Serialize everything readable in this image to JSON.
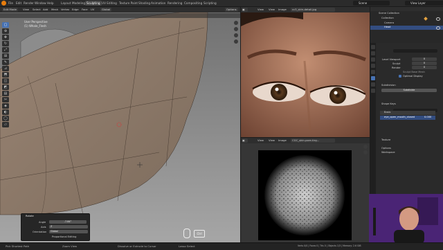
{
  "topbar": {
    "menus": [
      "File",
      "Edit",
      "Render",
      "Window",
      "Help"
    ],
    "workspaces": [
      "Layout",
      "Modeling",
      "Sculpting",
      "UV Editing",
      "Texture Paint",
      "Shading",
      "Animation",
      "Rendering",
      "Compositing",
      "Scripting"
    ],
    "active_workspace": "Sculpting",
    "scene": "Scene",
    "view_layer": "View Layer"
  },
  "viewport3d": {
    "mode": "Edit Mode",
    "header_items": [
      "View",
      "Select",
      "Add",
      "Mesh",
      "Vertex",
      "Edge",
      "Face",
      "UV"
    ],
    "orientation": "Global",
    "options": "Options",
    "overlay_line1": "User Perspective",
    "overlay_line2": "(1) Whale_Flesh",
    "operator_panel": {
      "title": "Rotate",
      "angle_label": "Angle",
      "angle_value": "-7.84°",
      "axis_label": "Axis",
      "axis_value": "Z",
      "orientation_label": "Orientation",
      "orientation_value": "Global",
      "proportional": "Proportional Editing"
    },
    "key_hint": "Ctrl"
  },
  "image_editor_top": {
    "header_items": [
      "View",
      "View",
      "Image"
    ],
    "image_name": "cc3_skin-detail.jpg"
  },
  "image_editor_bottom": {
    "header_items": [
      "View",
      "View",
      "Image"
    ],
    "image_name": "CGC_skin-pore-tiny..."
  },
  "outliner": {
    "title": "Scene Collection",
    "items": [
      "Collection",
      "Camera",
      "Head"
    ]
  },
  "properties": {
    "level_viewport_label": "Level Viewport",
    "level_viewport_value": "0",
    "sculpt_label": "Sculpt",
    "sculpt_value": "0",
    "render_label": "Render",
    "render_value": "0",
    "sculpt_base_mesh": "Sculpt Base Mesh",
    "optimal_display": "Optimal Display",
    "subdivision_label": "Subdivision",
    "subdivide_btn": "Subdivide",
    "shape_keys_label": "Shape Keys",
    "shape_key_basis": "Basis",
    "shape_key_mouth": "eye_open_mouth_closed",
    "shape_key_value": "0.000",
    "texture_label": "Texture",
    "options_label": "Options",
    "workspace_label": "Workspace"
  },
  "statusbar": {
    "left_hint": "Pick Shortest Path",
    "mid_hint": "Zoom View",
    "right_hint": "Dissolve or Extrude to Cursor",
    "lasso": "Lasso Select",
    "stats": "Verts 0/0 | Faces 0 | Tris 0 | Objects 1/3 | Memory: 2.6 GiB"
  },
  "colors": {
    "accent": "#4772b3",
    "active_tab": "#474747",
    "viewport_bg": "#8e8e8e",
    "mesh_fill": "#8a7868",
    "webcam_bg": "#5b2a86"
  }
}
